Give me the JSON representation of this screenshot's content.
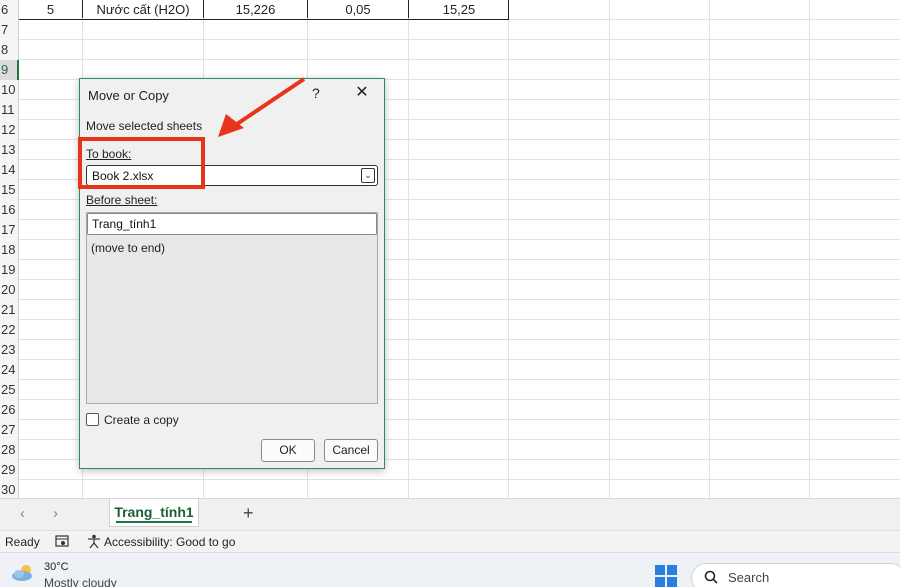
{
  "grid": {
    "data_row": {
      "row_number": "6",
      "cells": [
        "5",
        "Nước cất (H2O)",
        "15,226",
        "0,05",
        "15,25"
      ]
    },
    "row_numbers": [
      "7",
      "8",
      "9",
      "10",
      "11",
      "12",
      "13",
      "14",
      "15",
      "16",
      "17",
      "18",
      "19",
      "20",
      "21",
      "22",
      "23",
      "24",
      "25",
      "26",
      "27",
      "28",
      "29",
      "30"
    ]
  },
  "dialog": {
    "title": "Move or Copy",
    "help": "?",
    "close": "✕",
    "move_label": "Move selected sheets",
    "to_book_label": "To book:",
    "to_book_value": "Book 2.xlsx",
    "before_sheet_label": "Before sheet:",
    "sheets": [
      "Trang_tính1",
      "(move to end)"
    ],
    "create_copy_label": "Create a copy",
    "ok_label": "OK",
    "cancel_label": "Cancel"
  },
  "annotation": {
    "color": "#e8341b"
  },
  "tabs": {
    "prev": "‹",
    "next": "›",
    "active": "Trang_tính1",
    "add": "+"
  },
  "status": {
    "ready": "Ready",
    "accessibility": "Accessibility: Good to go"
  },
  "taskbar": {
    "temperature": "30°C",
    "condition": "Mostly cloudy",
    "search_placeholder": "Search"
  }
}
